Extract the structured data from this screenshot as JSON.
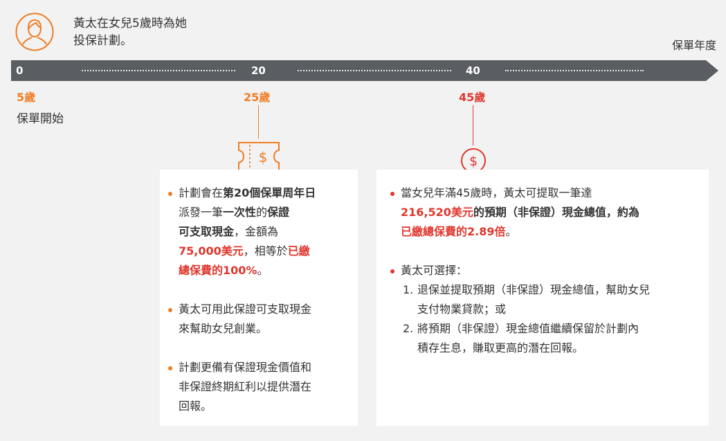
{
  "intro": {
    "line1": "黃太在女兒5歲時為她",
    "line2": "投保計劃。"
  },
  "timeline": {
    "axis_label": "保單年度",
    "ticks": [
      "0",
      "20",
      "40"
    ]
  },
  "milestones": {
    "start_age": "5歲",
    "start_label": "保單開始",
    "m1_age": "25歲",
    "m2_age": "45歲"
  },
  "icons": {
    "avatar": "person-outline-icon",
    "ticket": "cash-coupon-icon",
    "coin": "dollar-coin-icon"
  },
  "colors": {
    "orange": "#f07c22",
    "red": "#e0362c",
    "bar": "#5a5e62"
  },
  "box1": {
    "b1_t1": "計劃會在",
    "b1_t2": "第20個保單周年日",
    "b1_t3": "派發一筆",
    "b1_t4": "一次性",
    "b1_t5": "的",
    "b1_t6": "保證",
    "b1_t7": "可支取現金",
    "b1_t8": "，金額為",
    "b1_t9": "75,000美元",
    "b1_t10": "，相等於",
    "b1_t11": "已繳",
    "b1_t12": "總保費的100%",
    "b1_t13": "。",
    "b2_l1": "黃太可用此保證可支取現金",
    "b2_l2": "來幫助女兒創業。",
    "b3_l1": "計劃更備有保證現金價值和",
    "b3_l2": "非保證終期紅利以提供潛在",
    "b3_l3": "回報。"
  },
  "box2": {
    "b1_t1": "當女兒年滿45歲時，黃太可提取一筆達",
    "b1_t2": "216,520美元",
    "b1_t3": "的預期（非保證）現金總值，約為",
    "b1_t4": "已繳總保費的2.89倍",
    "b1_t5": "。",
    "b2_title": "黃太可選擇：",
    "opt1_num": "1.",
    "opt1_l1": "退保並提取預期（非保證）現金總值，幫助女兒",
    "opt1_l2": "支付物業貸款；或",
    "opt2_num": "2.",
    "opt2_l1": "將預期（非保證）現金總值繼續保留於計劃內",
    "opt2_l2": "積存生息，賺取更高的潛在回報。"
  }
}
